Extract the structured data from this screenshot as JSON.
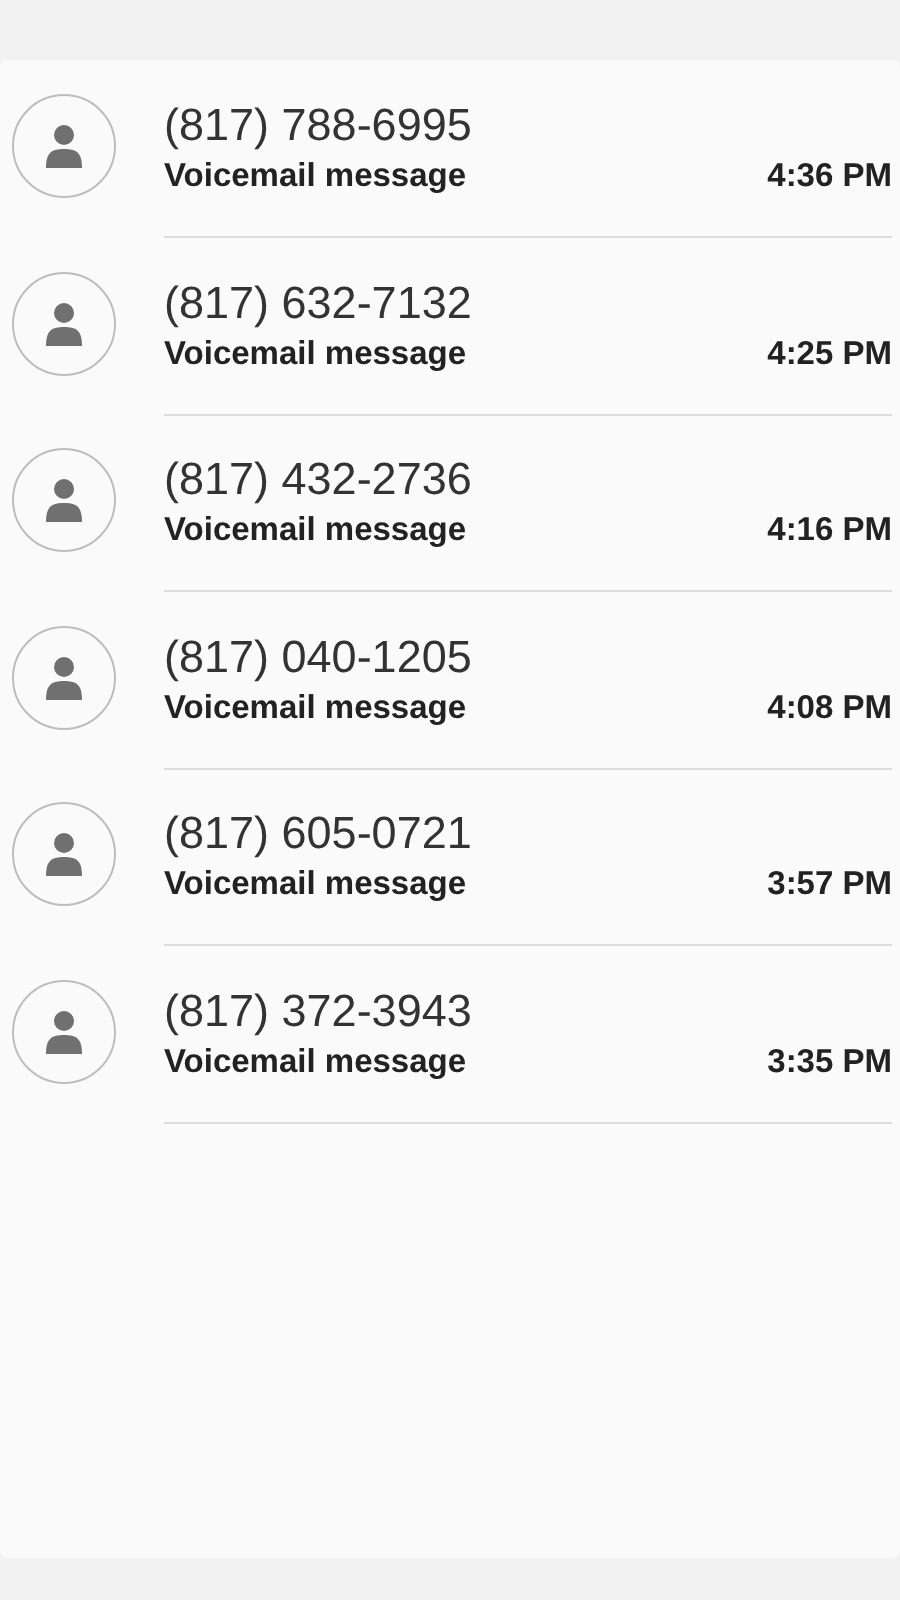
{
  "calls": [
    {
      "number": "(817) 788-6995",
      "label": "Voicemail message",
      "time": "4:36 PM"
    },
    {
      "number": "(817) 632-7132",
      "label": "Voicemail message",
      "time": "4:25 PM"
    },
    {
      "number": "(817) 432-2736",
      "label": "Voicemail message",
      "time": "4:16 PM"
    },
    {
      "number": "(817) 040-1205",
      "label": "Voicemail message",
      "time": "4:08 PM"
    },
    {
      "number": "(817) 605-0721",
      "label": "Voicemail message",
      "time": "3:57 PM"
    },
    {
      "number": "(817) 372-3943",
      "label": "Voicemail message",
      "time": "3:35 PM"
    }
  ]
}
